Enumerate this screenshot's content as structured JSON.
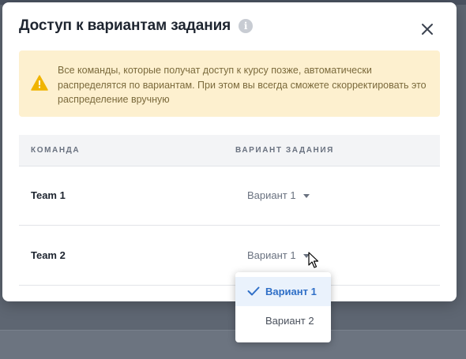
{
  "modal": {
    "title": "Доступ к вариантам задания",
    "info_icon": "info-icon",
    "close_icon": "close-icon"
  },
  "alert": {
    "icon": "warning-icon",
    "text": "Все команды, которые получат доступ к курсу позже, автоматически распределятся по вариантам. При этом вы всегда сможете скорректировать это распределение вручную"
  },
  "table": {
    "headers": [
      "КОМАНДА",
      "ВАРИАНТ ЗАДАНИЯ"
    ],
    "rows": [
      {
        "team": "Team 1",
        "variant": "Вариант 1"
      },
      {
        "team": "Team 2",
        "variant": "Вариант 1"
      }
    ]
  },
  "dropdown": {
    "options": [
      {
        "label": "Вариант 1",
        "selected": true
      },
      {
        "label": "Вариант 2",
        "selected": false
      }
    ]
  },
  "colors": {
    "alert_bg": "#fdf0cf",
    "alert_icon": "#f0b400",
    "accent": "#2f6fc7"
  }
}
